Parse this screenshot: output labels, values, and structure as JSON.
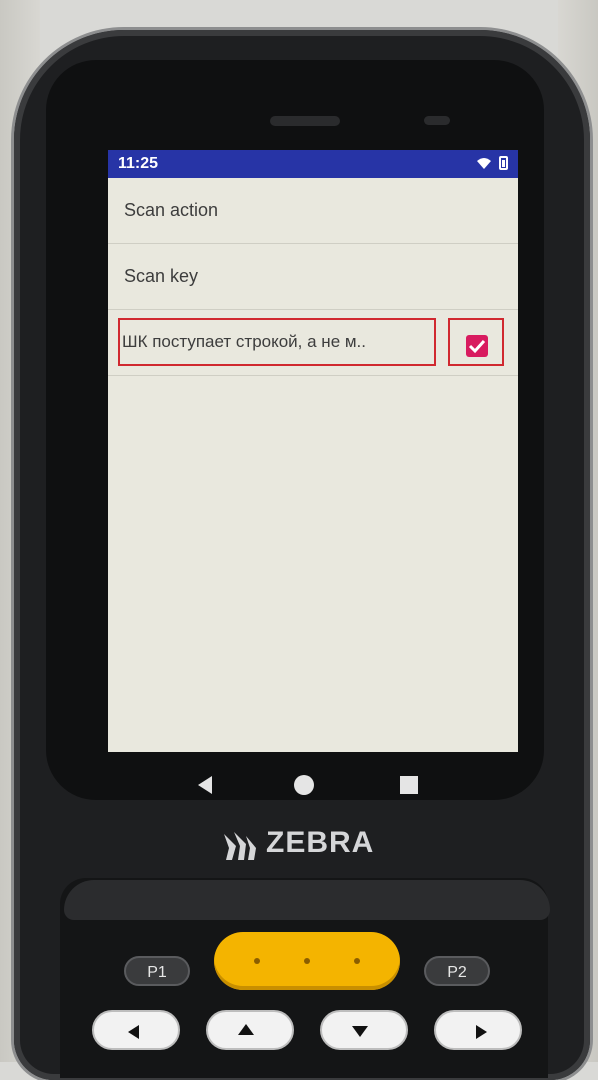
{
  "status_bar": {
    "time": "11:25",
    "color": "#2734a6",
    "icons": [
      "wifi-icon",
      "battery-icon"
    ]
  },
  "preferences": {
    "items": [
      {
        "label": "Scan action"
      },
      {
        "label": "Scan key"
      },
      {
        "label": "ШК поступает строкой, а не м..",
        "checked": true
      }
    ]
  },
  "device": {
    "brand": "ZEBRA",
    "keys": {
      "p1": "P1",
      "p2": "P2"
    }
  },
  "colors": {
    "accent": "#d81b5f",
    "highlight": "#d0282f",
    "screen_bg": "#e9e8de"
  }
}
